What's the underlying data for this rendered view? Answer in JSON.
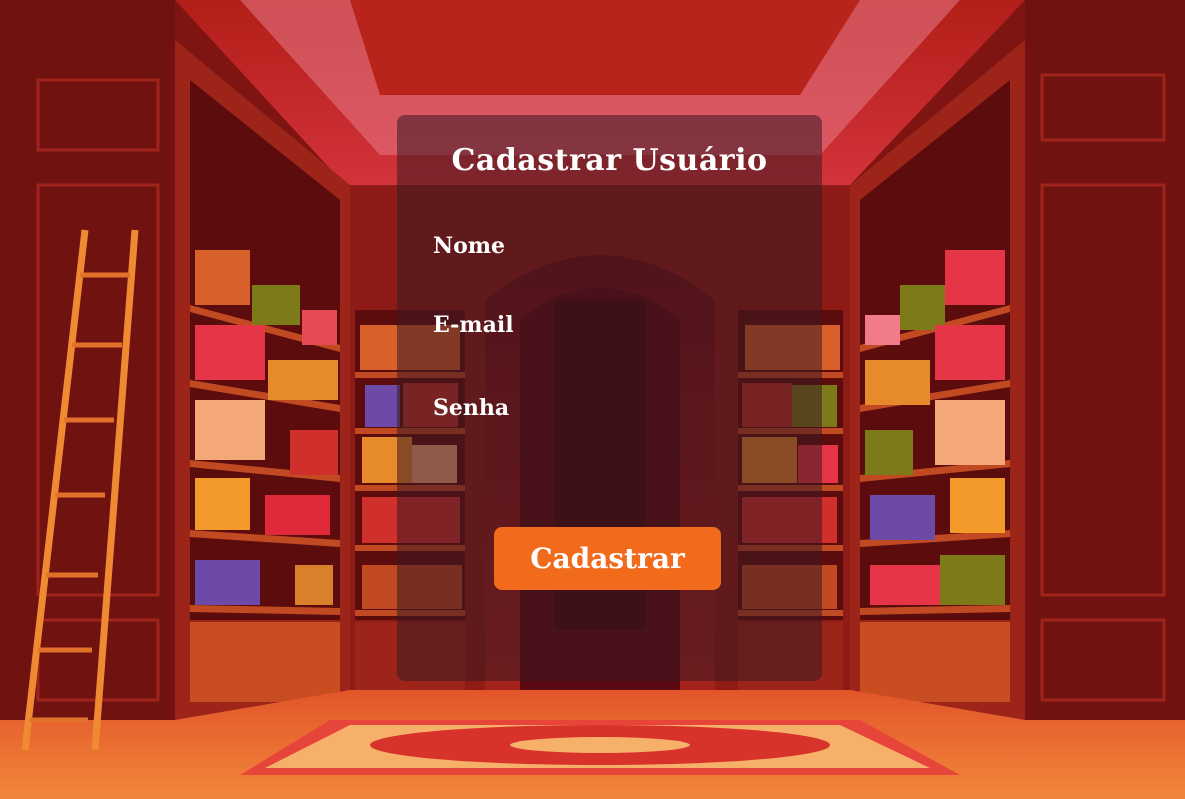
{
  "form": {
    "title": "Cadastrar Usuário",
    "fields": [
      {
        "label": "Nome",
        "value": ""
      },
      {
        "label": "E-mail",
        "value": ""
      },
      {
        "label": "Senha",
        "value": ""
      }
    ],
    "submit_label": "Cadastrar"
  },
  "colors": {
    "accent": "#f26b1d",
    "card_bg": "rgba(60,25,35,0.55)",
    "text": "#ffffff",
    "library_wood": "#8b1a14"
  }
}
